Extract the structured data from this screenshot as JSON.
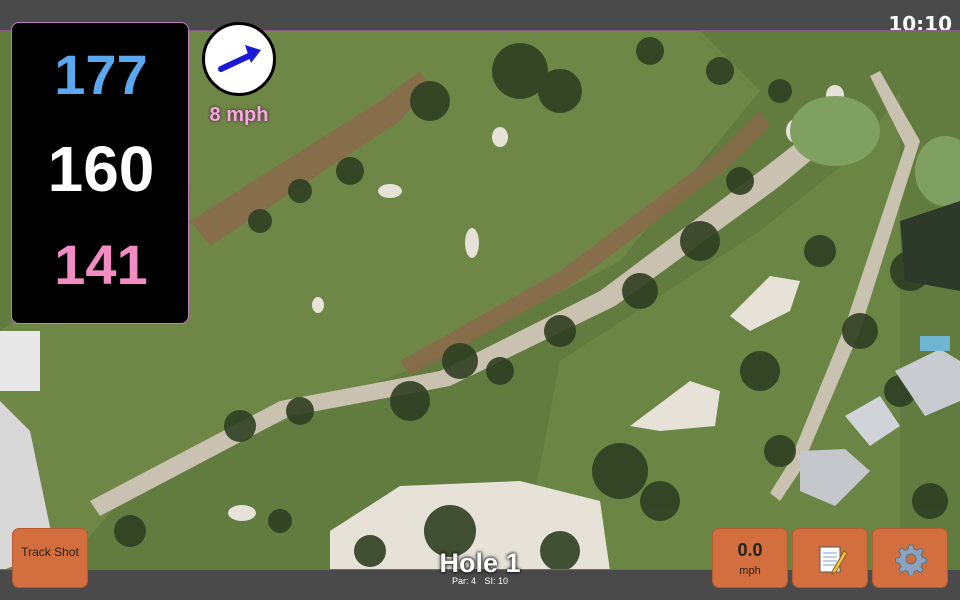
{
  "status_bar": {
    "time": "10:10"
  },
  "distances": {
    "back": "177",
    "center": "160",
    "front": "141"
  },
  "wind": {
    "speed_label": "8 mph",
    "icon": "wind-direction-arrow-icon",
    "arrow_color": "#1a1ad6"
  },
  "hole": {
    "title": "Hole 1",
    "par_label": "Par: 4",
    "si_label": "SI: 10"
  },
  "buttons": {
    "track_shot": "Track Shot",
    "speed_value": "0.0",
    "speed_unit": "mph",
    "notes_icon": "notepad-icon",
    "settings_icon": "gear-icon"
  },
  "colors": {
    "back_distance": "#5aa9f0",
    "center_distance": "#ffffff",
    "front_distance": "#f48cc4",
    "button": "#d36f3f",
    "panel": "#000000"
  }
}
